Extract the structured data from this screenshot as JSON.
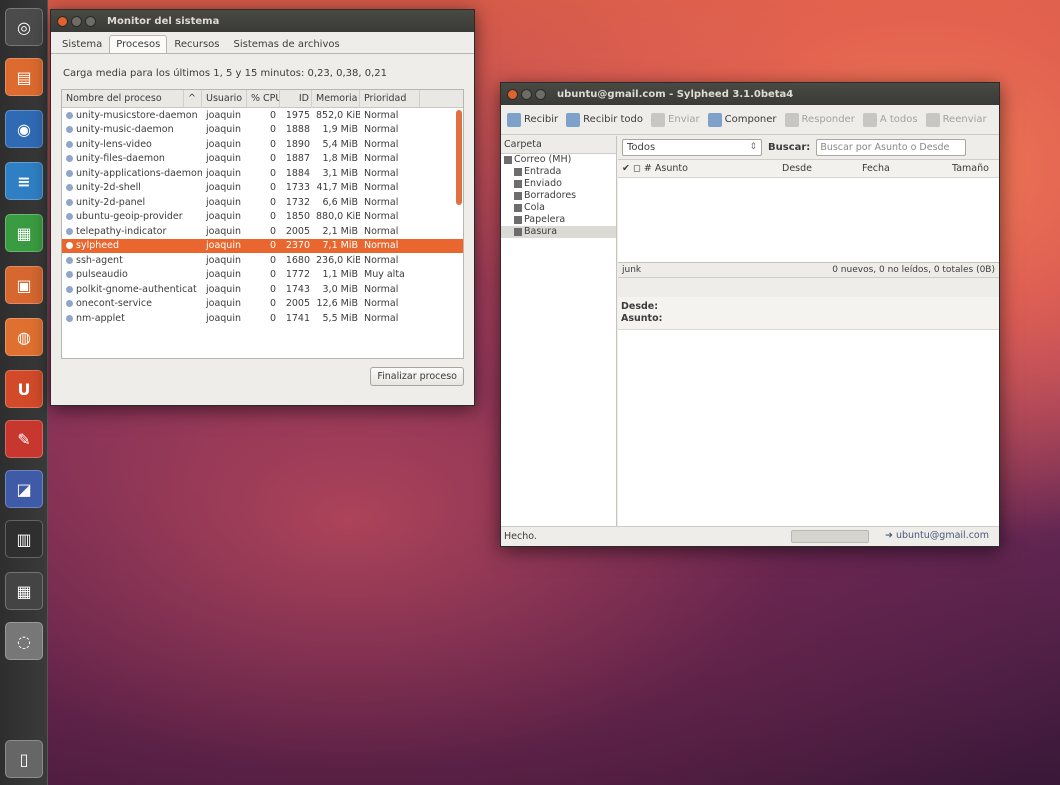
{
  "launcher": {
    "items": [
      {
        "name": "dash-home-icon",
        "glyph": "◎",
        "color": "#4b4b4b"
      },
      {
        "name": "files-icon",
        "glyph": "▤",
        "color": "#dd6a2e"
      },
      {
        "name": "firefox-icon",
        "glyph": "◉",
        "color": "#2f6bb5"
      },
      {
        "name": "writer-icon",
        "glyph": "≡",
        "color": "#2f7fc4"
      },
      {
        "name": "calc-icon",
        "glyph": "▦",
        "color": "#3a9c41"
      },
      {
        "name": "impress-icon",
        "glyph": "▣",
        "color": "#d6672f"
      },
      {
        "name": "software-center-icon",
        "glyph": "◍",
        "color": "#e07030"
      },
      {
        "name": "ubuntu-one-icon",
        "glyph": "U",
        "color": "#d24a2a"
      },
      {
        "name": "settings-icon",
        "glyph": "✎",
        "color": "#c8372e"
      },
      {
        "name": "system-monitor-icon",
        "glyph": "◪",
        "color": "#3f5ba8"
      },
      {
        "name": "terminal-icon",
        "glyph": "▥",
        "color": "#2f2f2f"
      },
      {
        "name": "workspaces-icon",
        "glyph": "▦",
        "color": "#444"
      },
      {
        "name": "disk-icon",
        "glyph": "◌",
        "color": "#777"
      },
      {
        "name": "trash-icon",
        "glyph": "▯",
        "color": "#666"
      }
    ]
  },
  "sysmon": {
    "title": "Monitor del sistema",
    "tabs": [
      "Sistema",
      "Procesos",
      "Recursos",
      "Sistemas de archivos"
    ],
    "active_tab": 1,
    "load": "Carga media para los últimos 1, 5 y 15 minutos: 0,23, 0,38, 0,21",
    "columns": [
      "Nombre del proceso",
      "Usuario",
      "% CPU",
      "ID",
      "Memoria",
      "Prioridad"
    ],
    "sort_indicator": "^",
    "rows": [
      [
        "unity-musicstore-daemon",
        "joaquin",
        "0",
        "1975",
        "852,0 KiB",
        "Normal"
      ],
      [
        "unity-music-daemon",
        "joaquin",
        "0",
        "1888",
        "1,9 MiB",
        "Normal"
      ],
      [
        "unity-lens-video",
        "joaquin",
        "0",
        "1890",
        "5,4 MiB",
        "Normal"
      ],
      [
        "unity-files-daemon",
        "joaquin",
        "0",
        "1887",
        "1,8 MiB",
        "Normal"
      ],
      [
        "unity-applications-daemon",
        "joaquin",
        "0",
        "1884",
        "3,1 MiB",
        "Normal"
      ],
      [
        "unity-2d-shell",
        "joaquin",
        "0",
        "1733",
        "41,7 MiB",
        "Normal"
      ],
      [
        "unity-2d-panel",
        "joaquin",
        "0",
        "1732",
        "6,6 MiB",
        "Normal"
      ],
      [
        "ubuntu-geoip-provider",
        "joaquin",
        "0",
        "1850",
        "880,0 KiB",
        "Normal"
      ],
      [
        "telepathy-indicator",
        "joaquin",
        "0",
        "2005",
        "2,1 MiB",
        "Normal"
      ],
      [
        "sylpheed",
        "joaquin",
        "0",
        "2370",
        "7,1 MiB",
        "Normal"
      ],
      [
        "ssh-agent",
        "joaquin",
        "0",
        "1680",
        "236,0 KiB",
        "Normal"
      ],
      [
        "pulseaudio",
        "joaquin",
        "0",
        "1772",
        "1,1 MiB",
        "Muy alta"
      ],
      [
        "polkit-gnome-authenticat",
        "joaquin",
        "0",
        "1743",
        "3,0 MiB",
        "Normal"
      ],
      [
        "onecont-service",
        "joaquin",
        "0",
        "2005",
        "12,6 MiB",
        "Normal"
      ],
      [
        "nm-applet",
        "joaquin",
        "0",
        "1741",
        "5,5 MiB",
        "Normal"
      ]
    ],
    "selected_row": 9,
    "end_button": "Finalizar proceso"
  },
  "sylpheed": {
    "title": "ubuntu@gmail.com - Sylpheed 3.1.0beta4",
    "toolbar": [
      {
        "label": "Recibir",
        "enabled": true
      },
      {
        "label": "Recibir todo",
        "enabled": true
      },
      {
        "label": "Enviar",
        "enabled": false
      },
      {
        "label": "Componer",
        "enabled": true
      },
      {
        "label": "Responder",
        "enabled": false
      },
      {
        "label": "A todos",
        "enabled": false
      },
      {
        "label": "Reenviar",
        "enabled": false
      }
    ],
    "folder_header": "Carpeta",
    "folders": [
      {
        "label": "Correo (MH)",
        "level": 0
      },
      {
        "label": "Entrada",
        "level": 1
      },
      {
        "label": "Enviado",
        "level": 1
      },
      {
        "label": "Borradores",
        "level": 1
      },
      {
        "label": "Cola",
        "level": 1
      },
      {
        "label": "Papelera",
        "level": 1
      },
      {
        "label": "Basura",
        "level": 1
      }
    ],
    "selected_folder": 6,
    "filter_value": "Todos",
    "search_label": "Buscar:",
    "search_placeholder": "Buscar por Asunto o Desde",
    "list_columns": [
      "✔ ◻ # Asunto",
      "Desde",
      "Fecha",
      "Tamaño"
    ],
    "info_folder": "junk",
    "info_counts": "0 nuevos, 0 no leídos, 0 totales (0B)",
    "preview_from": "Desde:",
    "preview_subject": "Asunto:",
    "status": "Hecho.",
    "account": "ubuntu@gmail.com"
  }
}
